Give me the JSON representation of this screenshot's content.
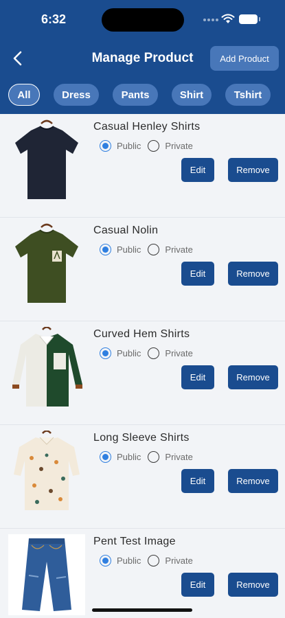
{
  "status_bar": {
    "time": "6:32"
  },
  "header": {
    "title": "Manage Product",
    "add_button_label": "Add Product"
  },
  "filters": [
    {
      "label": "All",
      "active": true
    },
    {
      "label": "Dress",
      "active": false
    },
    {
      "label": "Pants",
      "active": false
    },
    {
      "label": "Shirt",
      "active": false
    },
    {
      "label": "Tshirt",
      "active": false
    }
  ],
  "visibility_labels": {
    "public": "Public",
    "private": "Private"
  },
  "action_labels": {
    "edit": "Edit",
    "remove": "Remove"
  },
  "products": [
    {
      "name": "Casual Henley Shirts",
      "visibility": "public",
      "image": "navy-tshirt"
    },
    {
      "name": "Casual Nolin",
      "visibility": "public",
      "image": "olive-pocket-tshirt"
    },
    {
      "name": "Curved Hem Shirts",
      "visibility": "public",
      "image": "colorblock-shirt"
    },
    {
      "name": "Long Sleeve Shirts",
      "visibility": "public",
      "image": "printed-shirt"
    },
    {
      "name": "Pent Test Image",
      "visibility": "public",
      "image": "blue-jeans"
    }
  ],
  "colors": {
    "primary": "#1a4c8f",
    "chip": "#4877b9",
    "radio_selected": "#2f7fe0"
  }
}
